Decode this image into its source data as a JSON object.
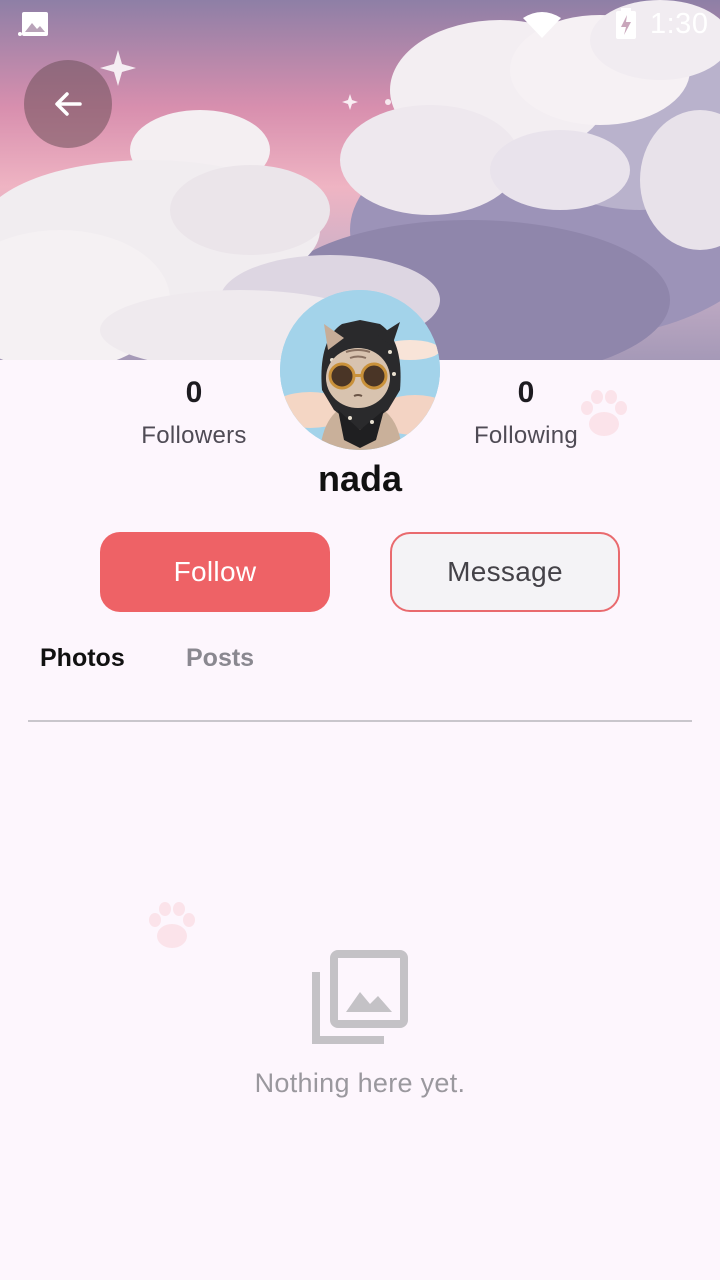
{
  "status_bar": {
    "time": "1:30",
    "icons": [
      "image-icon",
      "wifi-icon",
      "battery-charging-icon"
    ]
  },
  "profile": {
    "username": "nada",
    "followers_count": "0",
    "followers_label": "Followers",
    "following_count": "0",
    "following_label": "Following"
  },
  "actions": {
    "follow_label": "Follow",
    "message_label": "Message"
  },
  "tabs": [
    {
      "label": "Photos",
      "selected": true
    },
    {
      "label": "Posts",
      "selected": false
    }
  ],
  "empty_state": {
    "icon": "photo-library-icon",
    "text": "Nothing here yet."
  },
  "colors": {
    "accent": "#ee6266",
    "background": "#fdf6fd",
    "message_border": "#e96a6e",
    "paw_decoration": "#fbe3ea"
  }
}
